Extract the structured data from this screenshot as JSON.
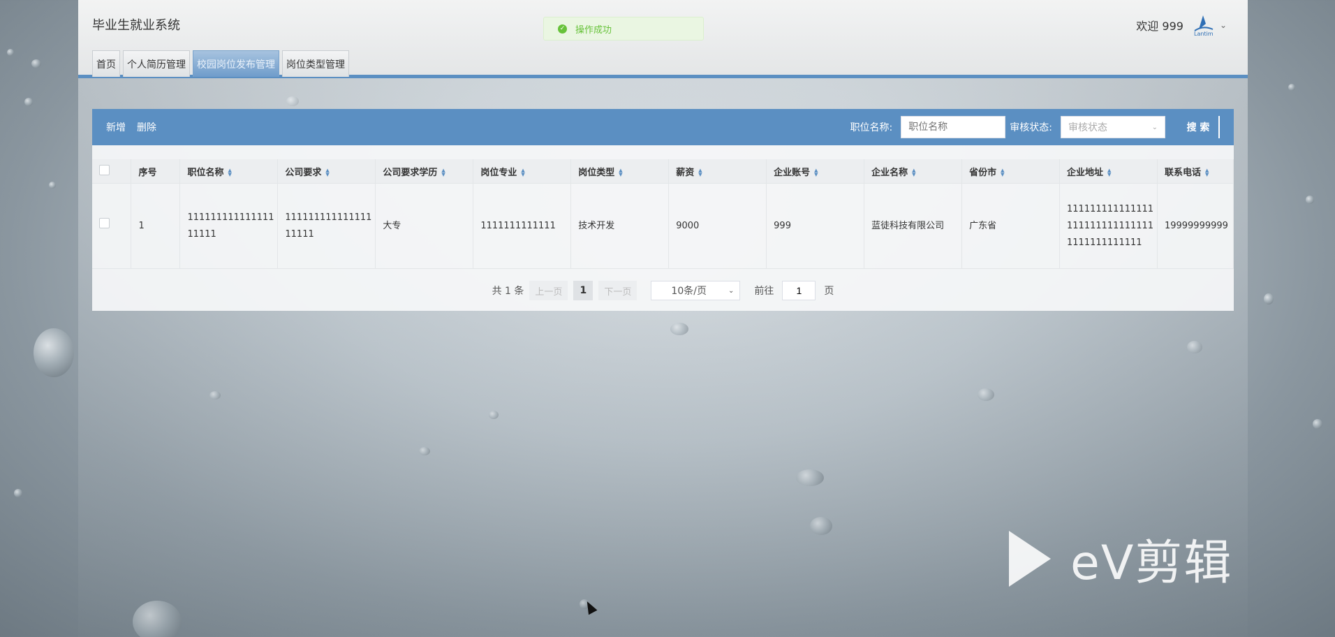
{
  "app": {
    "title": "毕业生就业系统",
    "toast": "操作成功",
    "welcome": "欢迎 999",
    "logo_text": "Lantim"
  },
  "tabs": [
    {
      "label": "首页"
    },
    {
      "label": "个人简历管理"
    },
    {
      "label": "校园岗位发布管理",
      "active": true
    },
    {
      "label": "岗位类型管理"
    }
  ],
  "toolbar": {
    "add_label": "新增",
    "delete_label": "删除",
    "position_label": "职位名称:",
    "position_placeholder": "职位名称",
    "status_label": "审核状态:",
    "status_placeholder": "审核状态",
    "search_label": "搜 索"
  },
  "table": {
    "headers": [
      "序号",
      "职位名称",
      "公司要求",
      "公司要求学历",
      "岗位专业",
      "岗位类型",
      "薪资",
      "企业账号",
      "企业名称",
      "省份市",
      "企业地址",
      "联系电话"
    ],
    "rows": [
      {
        "index": "1",
        "position": "11111111111111111111",
        "requirement": "11111111111111111111",
        "education": "大专",
        "major": "1111111111111",
        "type": "技术开发",
        "salary": "9000",
        "account": "999",
        "company": "蓝徒科技有限公司",
        "province": "广东省",
        "address": "1111111111111111111111111111111111111111111",
        "phone": "19999999999"
      }
    ]
  },
  "pagination": {
    "total": "共 1 条",
    "prev": "上一页",
    "current": "1",
    "next": "下一页",
    "page_size": "10条/页",
    "goto_label": "前往",
    "goto_value": "1",
    "page_suffix": "页"
  },
  "watermark": {
    "text": "eV剪辑"
  },
  "colors": {
    "accent": "#5b8fc2",
    "success": "#67c23a"
  }
}
